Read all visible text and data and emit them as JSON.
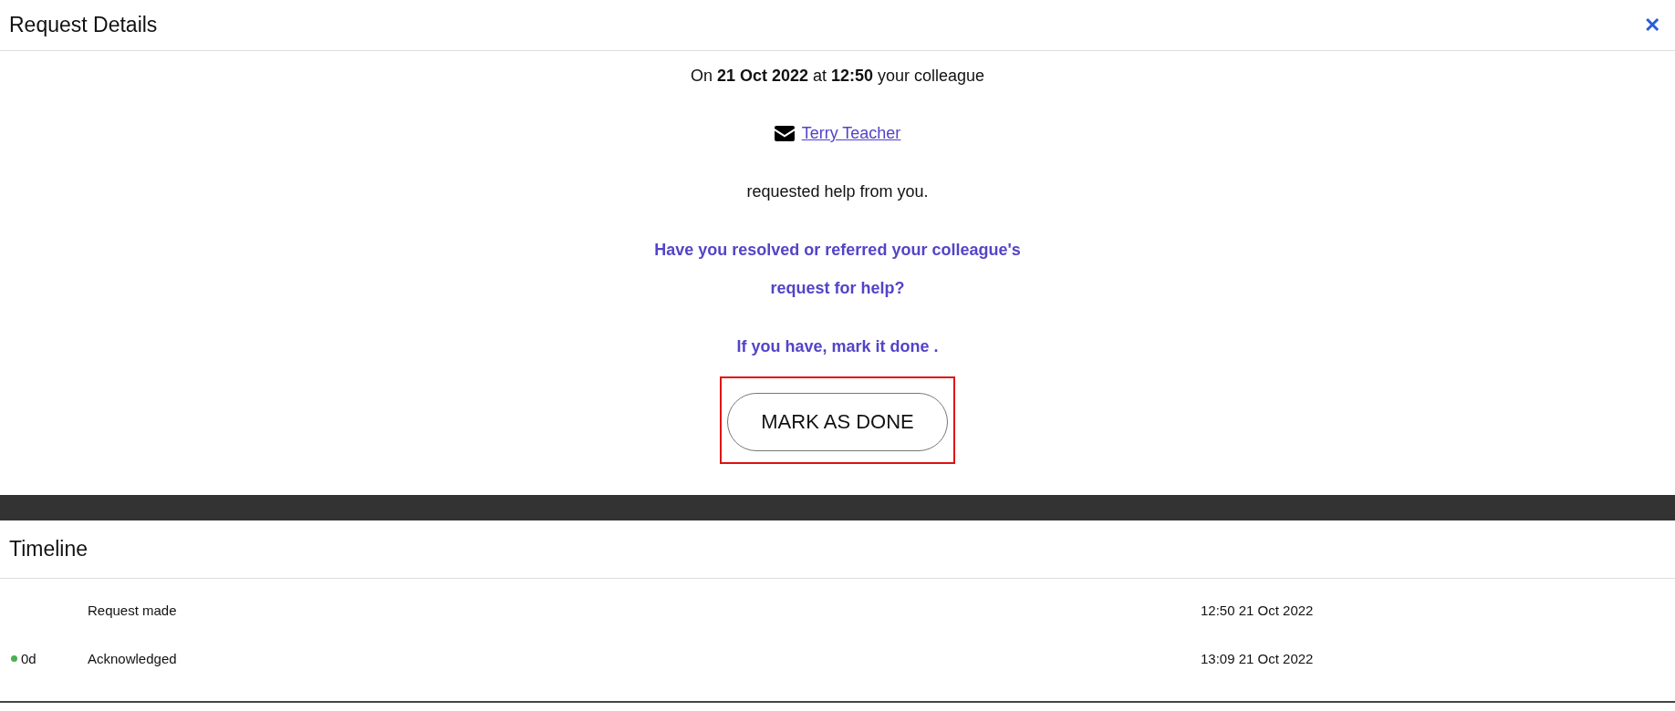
{
  "header": {
    "title": "Request Details",
    "close": "✕"
  },
  "intro": "On **21 Oct 2022** at **12:50** your colleague",
  "colleague": {
    "name": "Terry Teacher"
  },
  "requested": "requested help from you.",
  "question": "Have you resolved or referred your colleague's request for help?",
  "instruction": "If you have, mark it done .",
  "button": {
    "label": "MARK AS DONE",
    "highlighted": true
  },
  "timeline": {
    "title": "Timeline",
    "entries": [
      {
        "event": "Request made",
        "time": "12:50 21 Oct 2022"
      },
      {
        "age": "0d",
        "color": "#4caf50",
        "event": "Acknowledged",
        "time": "13:09 21 Oct 2022"
      }
    ]
  }
}
